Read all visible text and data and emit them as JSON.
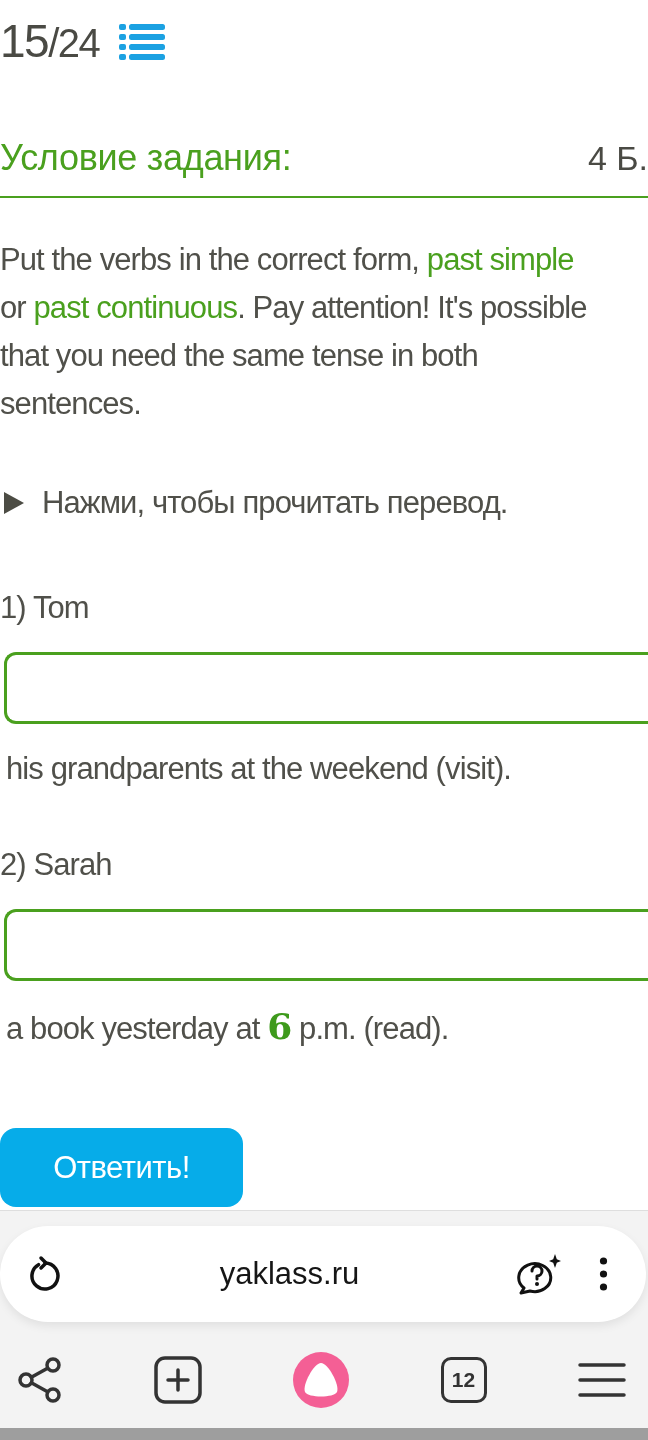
{
  "header": {
    "progress": {
      "current": "15",
      "total": "/24"
    }
  },
  "task": {
    "title": "Условие задания:",
    "points": "4 Б.",
    "instruction": [
      {
        "kind": "text",
        "text": "Put the verbs in the correct form, "
      },
      {
        "kind": "term",
        "text": "past simple"
      },
      {
        "kind": "text",
        "text": " or "
      },
      {
        "kind": "term",
        "text": "past continuous"
      },
      {
        "kind": "text",
        "text": ". Pay attention! It's possible that you need the same tense in both sentences."
      }
    ]
  },
  "translation": {
    "label": "Нажми, чтобы прочитать перевод.",
    "expanded": false
  },
  "questions": [
    {
      "prompt": "1) Tom",
      "continuation": [
        {
          "kind": "text",
          "text": "his grandparents at the weekend (visit)."
        }
      ]
    },
    {
      "prompt": "2) Sarah",
      "continuation": [
        {
          "kind": "text",
          "text": "a book yesterday at "
        },
        {
          "kind": "math",
          "text": "6"
        },
        {
          "kind": "text",
          "text": " p.m. (read)."
        }
      ]
    }
  ],
  "submit": {
    "label": "Ответить!"
  },
  "browser": {
    "url": "yaklass.ru",
    "tab_count": "12"
  }
}
